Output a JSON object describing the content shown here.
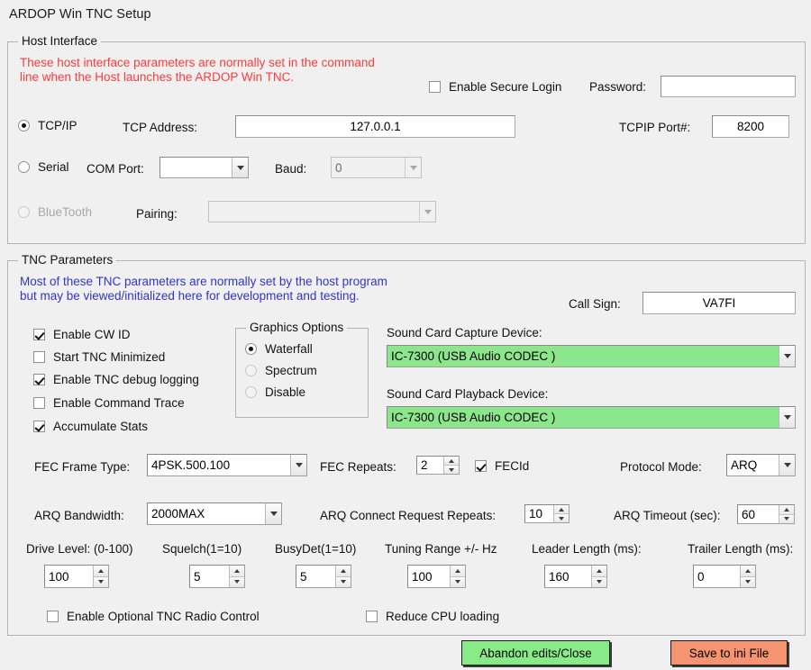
{
  "window": {
    "title": "ARDOP Win TNC Setup"
  },
  "host_interface": {
    "legend": "Host Interface",
    "note_line1": "These host interface parameters are normally set in the command",
    "note_line2": "line when the Host launches the ARDOP Win TNC.",
    "note_color": "#ff3b3b",
    "secure_login": {
      "label": "Enable Secure Login",
      "checked": false
    },
    "password": {
      "label": "Password:",
      "value": ""
    },
    "tcpip_radio": {
      "label": "TCP/IP",
      "selected": true
    },
    "tcp_address": {
      "label": "TCP Address:",
      "value": "127.0.0.1"
    },
    "tcpip_port": {
      "label": "TCPIP Port#:",
      "value": "8200"
    },
    "serial_radio": {
      "label": "Serial",
      "selected": false
    },
    "com_port": {
      "label": "COM Port:",
      "value": ""
    },
    "baud": {
      "label": "Baud:",
      "value": "0"
    },
    "bluetooth_radio": {
      "label": "BlueTooth",
      "selected": false,
      "disabled": true
    },
    "pairing": {
      "label": "Pairing:",
      "value": ""
    }
  },
  "tnc_parameters": {
    "legend": "TNC Parameters",
    "note_line1": "Most of these TNC parameters are normally set by the host program",
    "note_line2": "but may be viewed/initialized here for development and testing.",
    "note_color": "#3333cc",
    "call_sign": {
      "label": "Call Sign:",
      "value": "VA7FI"
    },
    "checks": [
      {
        "label": "Enable CW ID",
        "checked": true
      },
      {
        "label": "Start TNC Minimized",
        "checked": false
      },
      {
        "label": "Enable TNC debug logging",
        "checked": true
      },
      {
        "label": "Enable Command Trace",
        "checked": false
      },
      {
        "label": "Accumulate Stats",
        "checked": true
      }
    ],
    "graphics_options": {
      "legend": "Graphics Options",
      "options": [
        {
          "label": "Waterfall",
          "selected": true
        },
        {
          "label": "Spectrum",
          "selected": false
        },
        {
          "label": "Disable",
          "selected": false
        }
      ]
    },
    "capture_device": {
      "label": "Sound Card Capture Device:",
      "value": "IC-7300 (USB Audio CODEC )",
      "highlight": "#8ce68c"
    },
    "playback_device": {
      "label": "Sound Card Playback Device:",
      "value": "IC-7300 (USB Audio CODEC )",
      "highlight": "#8ce68c"
    },
    "fec_frame_type": {
      "label": "FEC Frame Type:",
      "value": "4PSK.500.100"
    },
    "fec_repeats": {
      "label": "FEC Repeats:",
      "value": "2"
    },
    "fecid": {
      "label": "FECId",
      "checked": true
    },
    "protocol_mode": {
      "label": "Protocol Mode:",
      "value": "ARQ"
    },
    "arq_bandwidth": {
      "label": "ARQ Bandwidth:",
      "value": "2000MAX"
    },
    "arq_connect_repeats": {
      "label": "ARQ Connect Request Repeats:",
      "value": "10"
    },
    "arq_timeout": {
      "label": "ARQ Timeout (sec):",
      "value": "60"
    },
    "drive_level": {
      "label": "Drive Level: (0-100)",
      "value": "100"
    },
    "squelch": {
      "label": "Squelch(1=10)",
      "value": "5"
    },
    "busydet": {
      "label": "BusyDet(1=10)",
      "value": "5"
    },
    "tuning_range": {
      "label": "Tuning Range +/- Hz",
      "value": "100"
    },
    "leader_length": {
      "label": "Leader Length (ms):",
      "value": "160"
    },
    "trailer_length": {
      "label": "Trailer Length (ms):",
      "value": "0"
    },
    "radio_control": {
      "label": "Enable Optional TNC Radio Control",
      "checked": false
    },
    "reduce_cpu": {
      "label": "Reduce CPU loading",
      "checked": false
    }
  },
  "footer": {
    "abandon_button": {
      "label": "Abandon edits/Close",
      "color": "#88eb88"
    },
    "save_button": {
      "label": "Save to ini File",
      "color": "#f59470"
    }
  }
}
